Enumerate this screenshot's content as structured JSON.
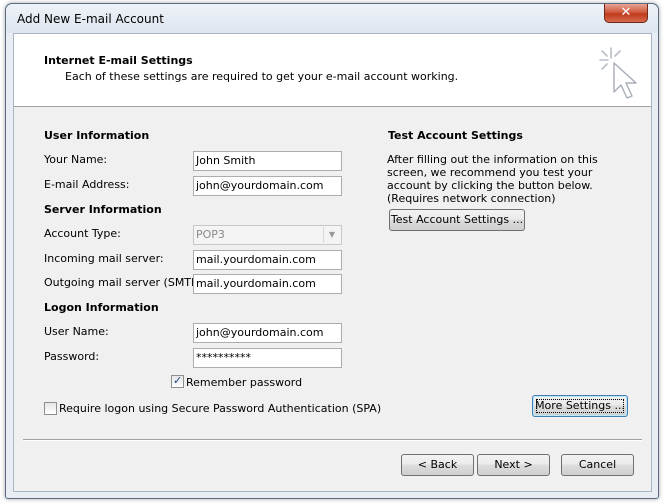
{
  "window": {
    "title": "Add New E-mail Account",
    "close_glyph": "✕"
  },
  "header": {
    "title": "Internet E-mail Settings",
    "subtitle": "Each of these settings are required to get your e-mail account working.",
    "icon": "cursor-sparkle-icon"
  },
  "user_info": {
    "heading": "User Information",
    "name_label": "Your Name:",
    "name_value": "John Smith",
    "email_label": "E-mail Address:",
    "email_value": "john@yourdomain.com"
  },
  "server_info": {
    "heading": "Server Information",
    "account_type_label": "Account Type:",
    "account_type_value": "POP3",
    "incoming_label": "Incoming mail server:",
    "incoming_value": "mail.yourdomain.com",
    "outgoing_label": "Outgoing mail server (SMTP):",
    "outgoing_value": "mail.yourdomain.com"
  },
  "logon_info": {
    "heading": "Logon Information",
    "username_label": "User Name:",
    "username_value": "john@yourdomain.com",
    "password_label": "Password:",
    "password_value": "**********",
    "remember_label": "Remember password",
    "remember_checked": true,
    "spa_label": "Require logon using Secure Password Authentication (SPA)",
    "spa_checked": false
  },
  "test_settings": {
    "heading": "Test Account Settings",
    "description": "After filling out the information on this screen, we recommend you test your account by clicking the button below. (Requires network connection)",
    "button_label": "Test Account Settings ..."
  },
  "more_settings_label": "More Settings ...",
  "footer": {
    "back_label": "< Back",
    "next_label": "Next >",
    "cancel_label": "Cancel"
  }
}
